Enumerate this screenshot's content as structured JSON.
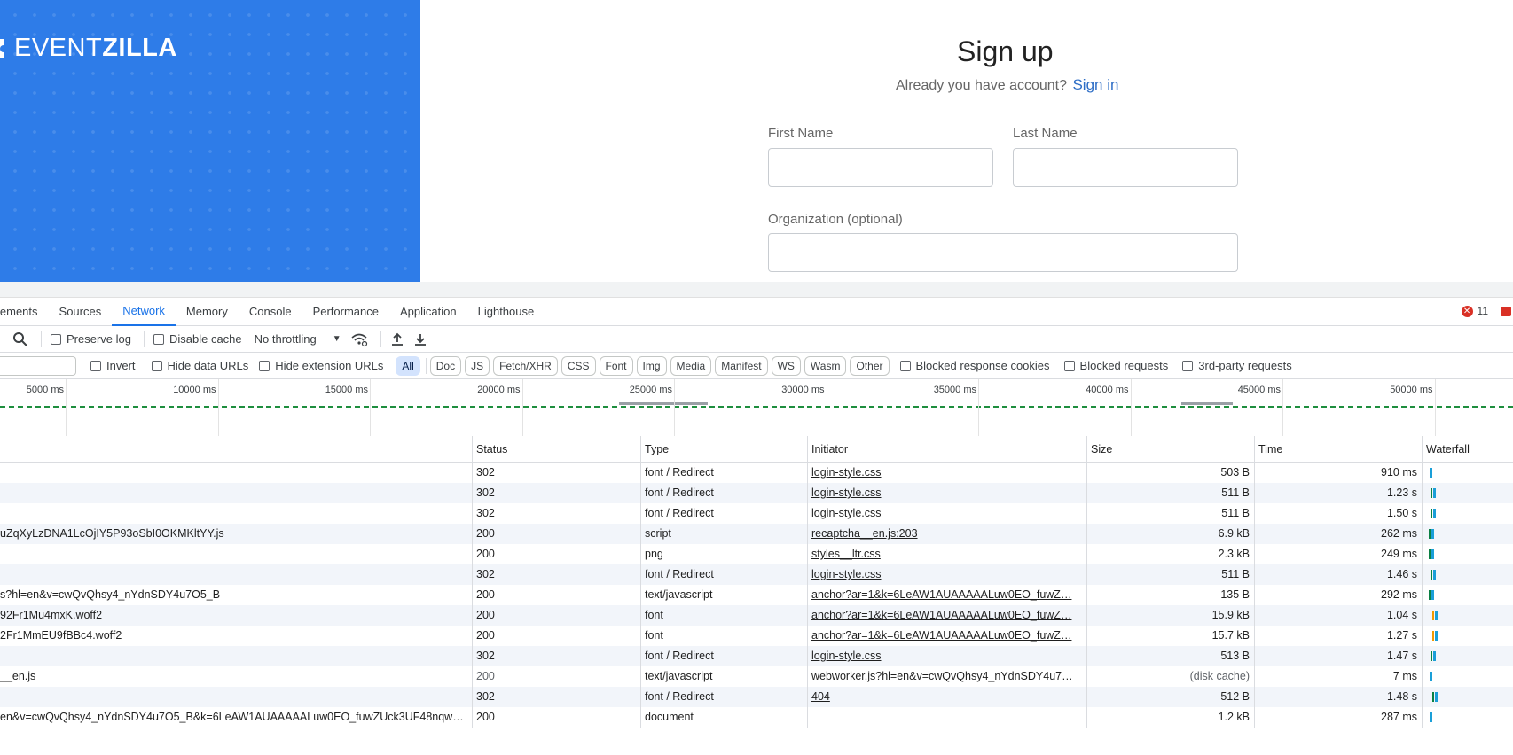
{
  "page": {
    "logo": {
      "part1": "EVENT",
      "part2": "ZILLA"
    },
    "title": "Sign up",
    "signin_prompt": "Already you have account?",
    "signin_link": "Sign in",
    "first_name_label": "First Name",
    "last_name_label": "Last Name",
    "organization_label": "Organization (optional)",
    "colors": {
      "hero": "#2e7ce8",
      "link": "#2e6ec6"
    }
  },
  "devtools": {
    "tabs": [
      "lements",
      "Sources",
      "Network",
      "Memory",
      "Console",
      "Performance",
      "Application",
      "Lighthouse"
    ],
    "active_tab": "Network",
    "error_count": "11",
    "toolbar1": {
      "preserve_log": "Preserve log",
      "disable_cache": "Disable cache",
      "throttling": "No throttling"
    },
    "toolbar2": {
      "invert": "Invert",
      "hide_data_urls": "Hide data URLs",
      "hide_extension_urls": "Hide extension URLs",
      "chips": [
        "All",
        "Doc",
        "JS",
        "Fetch/XHR",
        "CSS",
        "Font",
        "Img",
        "Media",
        "Manifest",
        "WS",
        "Wasm",
        "Other"
      ],
      "blocked_cookies": "Blocked response cookies",
      "blocked_requests": "Blocked requests",
      "third_party": "3rd-party requests"
    },
    "overview_ticks": [
      "5000 ms",
      "10000 ms",
      "15000 ms",
      "20000 ms",
      "25000 ms",
      "30000 ms",
      "35000 ms",
      "40000 ms",
      "45000 ms",
      "50000 ms"
    ],
    "columns": {
      "status": "Status",
      "type": "Type",
      "initiator": "Initiator",
      "size": "Size",
      "time": "Time",
      "waterfall": "Waterfall"
    },
    "rows": [
      {
        "name": "",
        "status": "302",
        "type": "font / Redirect",
        "initiator": "login-style.css",
        "size": "503 B",
        "time": "910 ms"
      },
      {
        "name": "",
        "status": "302",
        "type": "font / Redirect",
        "initiator": "login-style.css",
        "size": "511 B",
        "time": "1.23 s"
      },
      {
        "name": "",
        "status": "302",
        "type": "font / Redirect",
        "initiator": "login-style.css",
        "size": "511 B",
        "time": "1.50 s"
      },
      {
        "name": "uZqXyLzDNA1LcOjIY5P93oSbI0OKMKltYY.js",
        "status": "200",
        "type": "script",
        "initiator": "recaptcha__en.js:203",
        "size": "6.9 kB",
        "time": "262 ms"
      },
      {
        "name": "",
        "status": "200",
        "type": "png",
        "initiator": "styles__ltr.css",
        "size": "2.3 kB",
        "time": "249 ms"
      },
      {
        "name": "",
        "status": "302",
        "type": "font / Redirect",
        "initiator": "login-style.css",
        "size": "511 B",
        "time": "1.46 s"
      },
      {
        "name": "s?hl=en&v=cwQvQhsy4_nYdnSDY4u7O5_B",
        "status": "200",
        "type": "text/javascript",
        "initiator": "anchor?ar=1&k=6LeAW1AUAAAAALuw0EO_fuwZ…",
        "size": "135 B",
        "time": "292 ms"
      },
      {
        "name": "92Fr1Mu4mxK.woff2",
        "status": "200",
        "type": "font",
        "initiator": "anchor?ar=1&k=6LeAW1AUAAAAALuw0EO_fuwZ…",
        "size": "15.9 kB",
        "time": "1.04 s"
      },
      {
        "name": "2Fr1MmEU9fBBc4.woff2",
        "status": "200",
        "type": "font",
        "initiator": "anchor?ar=1&k=6LeAW1AUAAAAALuw0EO_fuwZ…",
        "size": "15.7 kB",
        "time": "1.27 s"
      },
      {
        "name": "",
        "status": "302",
        "type": "font / Redirect",
        "initiator": "login-style.css",
        "size": "513 B",
        "time": "1.47 s"
      },
      {
        "name": "__en.js",
        "status": "200",
        "type": "text/javascript",
        "initiator": "webworker.js?hl=en&v=cwQvQhsy4_nYdnSDY4u7…",
        "size": "(disk cache)",
        "time": "7 ms"
      },
      {
        "name": "",
        "status": "302",
        "type": "font / Redirect",
        "initiator": "404",
        "size": "512 B",
        "time": "1.48 s"
      },
      {
        "name": "en&v=cwQvQhsy4_nYdnSDY4u7O5_B&k=6LeAW1AUAAAAALuw0EO_fuwZUck3UF48nqw…",
        "status": "200",
        "type": "document",
        "initiator": "",
        "size": "1.2 kB",
        "time": "287 ms"
      }
    ]
  }
}
